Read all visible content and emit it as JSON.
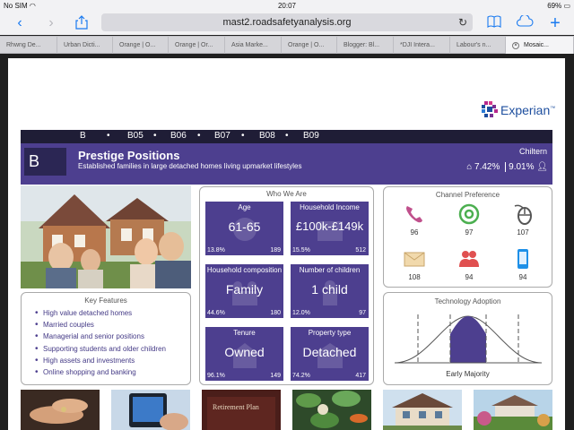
{
  "status_bar": {
    "carrier": "No SIM",
    "time": "20:07",
    "battery": "69%"
  },
  "browser": {
    "url": "mast2.roadsafetyanalysis.org",
    "tabs": [
      {
        "label": "Rhwng De..."
      },
      {
        "label": "Urban Dicti..."
      },
      {
        "label": "Orange | O..."
      },
      {
        "label": "Orange | Or..."
      },
      {
        "label": "Asia Marke..."
      },
      {
        "label": "Orange | O..."
      },
      {
        "label": "Blogger: Bl..."
      },
      {
        "label": "*DJI Intera..."
      },
      {
        "label": "Labour's n..."
      },
      {
        "label": "Mosaic..."
      }
    ],
    "icons": {
      "back": "chevron-left-icon",
      "forward": "chevron-right-icon",
      "share": "share-icon",
      "reload": "reload-icon",
      "bookmarks": "book-icon",
      "cloud": "cloud-icon",
      "new_tab": "plus-icon"
    }
  },
  "logo": {
    "text": "Experian",
    "superscript": "™"
  },
  "group_strip": {
    "items": [
      "B",
      "•",
      "B05",
      "•",
      "B06",
      "•",
      "B07",
      "•",
      "B08",
      "•",
      "B09"
    ]
  },
  "banner": {
    "code": "B",
    "title": "Prestige Positions",
    "description": "Established families in large detached homes living upmarket lifestyles",
    "region": "Chiltern",
    "household_pct": "7.42%",
    "population_pct": "9.01%"
  },
  "key_features": {
    "title": "Key Features",
    "items": [
      "High value detached homes",
      "Married couples",
      "Managerial and senior positions",
      "Supporting students and older children",
      "High assets and investments",
      "Online shopping and banking"
    ]
  },
  "who_we_are": {
    "title": "Who We Are",
    "tiles": [
      {
        "label": "Age",
        "value": "61-65",
        "pct": "13.8%",
        "index": "189"
      },
      {
        "label": "Household Income",
        "value": "£100k-£149k",
        "pct": "15.5%",
        "index": "512"
      },
      {
        "label": "Household composition",
        "value": "Family",
        "pct": "44.6%",
        "index": "180"
      },
      {
        "label": "Number of children",
        "value": "1 child",
        "pct": "12.0%",
        "index": "97"
      },
      {
        "label": "Tenure",
        "value": "Owned",
        "pct": "96.1%",
        "index": "149"
      },
      {
        "label": "Property type",
        "value": "Detached",
        "pct": "74.2%",
        "index": "417"
      }
    ]
  },
  "channel_preference": {
    "title": "Channel Preference",
    "items": [
      {
        "icon": "telephone-icon",
        "value": "96",
        "color": "#c0508c"
      },
      {
        "icon": "email-icon",
        "value": "97",
        "color": "#4caf50"
      },
      {
        "icon": "mouse-icon",
        "value": "107",
        "color": "#555555"
      },
      {
        "icon": "letter-icon",
        "value": "108",
        "color": "#e8c890"
      },
      {
        "icon": "people-icon",
        "value": "94",
        "color": "#e05050"
      },
      {
        "icon": "mobile-phone-icon",
        "value": "94",
        "color": "#1e90e8"
      }
    ]
  },
  "technology_adoption": {
    "title": "Technology Adoption",
    "label": "Early Majority"
  },
  "colors": {
    "accent": "#4d3f8f",
    "dark_strip": "#1f1d36",
    "link_blue": "#1a7af0"
  }
}
